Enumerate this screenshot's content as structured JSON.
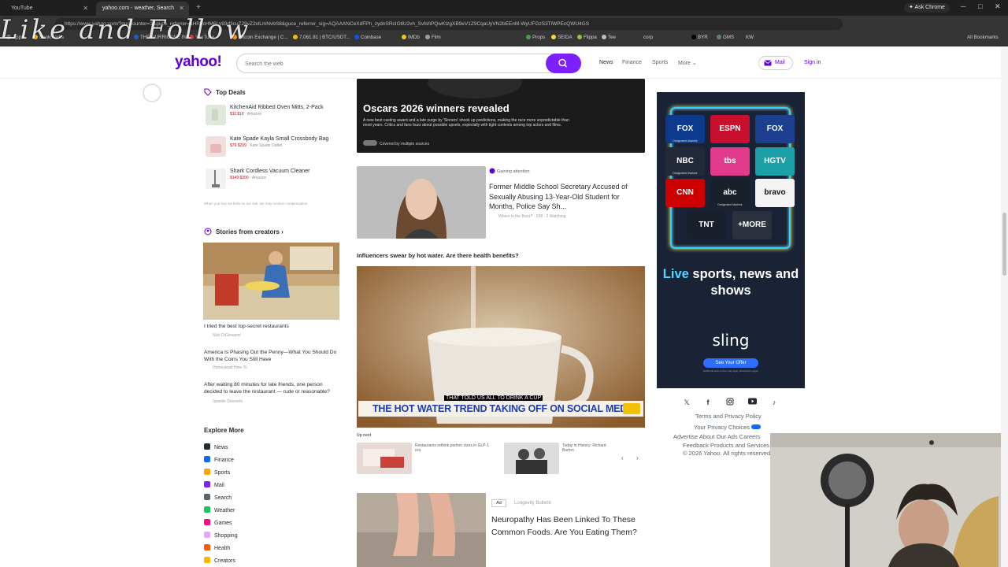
{
  "browser": {
    "tabs": [
      {
        "label": "YouTube"
      },
      {
        "label": "yahoo.com - weather, Search",
        "active": true
      }
    ],
    "ask_chrome": "Ask Chrome",
    "url": "https://www.yahoo.com/?guccounter=1&guce_referrer=aHR0cHM6Ly93d3cuZ29vZ2xlLmNvbS8&guce_referrer_sig=AQAAANCeXdFPh_zydnSRcIGtlU2vh_SvfshPQwKtzgXB9eV1Z9CqaUyVN2bEEnM-WyUFGzS3TlWPEcQWU4GS",
    "bookmarks": [
      "Apps",
      "Bookmarks",
      "THE HURRICANE INT...",
      "YouTube",
      "Bitcoin Exchange | C...",
      "7,061.81 | BTC/USDT...",
      "Coinbase",
      "IMDb",
      "Film",
      "Props",
      "SEIDA",
      "Flippa",
      "Tee",
      "corp",
      "BYR",
      "GMS",
      "KW",
      "All Bookmarks"
    ],
    "watermark": "Like and Follow"
  },
  "header": {
    "logo": "yahoo!",
    "search_placeholder": "Search the web",
    "nav": [
      "News",
      "Finance",
      "Sports",
      "More"
    ],
    "mail": "Mail",
    "signin": "Sign in"
  },
  "left": {
    "top_deals_title": "Top Deals",
    "deals": [
      {
        "name": "KitchenAid Ribbed Oven Mitts, 2-Pack",
        "price": "$11 $16",
        "store": "Amazon"
      },
      {
        "name": "Kate Spade Kayla Small Crossbody Bag",
        "price": "$79 $299",
        "store": "Kate Spade Outlet"
      },
      {
        "name": "Shark Cordless Vacuum Cleaner",
        "price": "$149 $300",
        "store": "Amazon"
      }
    ],
    "deals_note": "When you buy via links on our site, we may receive compensation.",
    "creators_title": "Stories from creators",
    "creator_story_1": "I tried the best top-secret restaurants",
    "creator_story_1_src": "Nick DiGiovanni",
    "creator_story_2": "America Is Phasing Out the Penny—What You Should Do With the Coins You Still Have",
    "creator_story_2_src": "Homestead How-To",
    "creator_story_3": "After waiting 80 minutes for late friends, one person decided to leave the restaurant — rude or reasonable?",
    "creator_story_3_src": "Sparkle Desserts",
    "explore_title": "Explore More",
    "explore": [
      {
        "label": "News",
        "color": "#232a31"
      },
      {
        "label": "Finance",
        "color": "#0f69ff"
      },
      {
        "label": "Sports",
        "color": "#ffa700"
      },
      {
        "label": "Mail",
        "color": "#7e1fff"
      },
      {
        "label": "Search",
        "color": "#5b636a"
      },
      {
        "label": "Weather",
        "color": "#1ac567"
      },
      {
        "label": "Games",
        "color": "#ff0b80"
      },
      {
        "label": "Shopping",
        "color": "#e0a8ff"
      },
      {
        "label": "Health",
        "color": "#ff5a00"
      },
      {
        "label": "Creators",
        "color": "#fdb700"
      }
    ]
  },
  "main": {
    "hero_title": "Oscars 2026 winners revealed",
    "hero_desc": "A new best casting award and a late surge by 'Sinners' shook up predictions, making the race more unpredictable than most years. Critics and fans buzz about possible upsets, especially with tight contests among top actors and films.",
    "hero_src": "Covered by multiple sources",
    "story_tag": "Gaining attention",
    "story_title": "Former Middle School Secretary Accused of Sexually Abusing 13-Year-Old Student for Months, Police Say Sh...",
    "story_meta": "Where is the Buzz? · 208 · 2 Watching",
    "video_heading": "Influencers swear by hot water. Are there health benefits?",
    "subtitle_small": "THAT TOLD US ALL TO DRINK A CUP",
    "subtitle_big": "THE HOT WATER TREND TAKING OFF ON SOCIAL MEDIA",
    "up_next": "Up next",
    "up_next_items": [
      {
        "caption": "Restaurants rethink portion sizes in GLP-1 era"
      },
      {
        "caption": "Today in History: Richard Burton"
      }
    ],
    "ad_badge": "Ad",
    "ad_sponsor": "Longevity Bulletin",
    "ad_title": "Neuropathy Has Been Linked To These Common Foods. Are You Eating Them?"
  },
  "right": {
    "networks": [
      {
        "label": "FOX",
        "sub": "Designated Markets",
        "color": "#0c3a8c"
      },
      {
        "label": "ESPN",
        "sub": "",
        "color": "#c8102e"
      },
      {
        "label": "FOX NEWS",
        "sub": "",
        "color": "#1d3f8f"
      },
      {
        "label": "NBC",
        "sub": "Designated Markets",
        "color": "#222a3a"
      },
      {
        "label": "tbs",
        "sub": "",
        "color": "#e23a8c"
      },
      {
        "label": "HGTV",
        "sub": "",
        "color": "#1ba0a8"
      },
      {
        "label": "CNN",
        "sub": "",
        "color": "#cc0000"
      },
      {
        "label": "abc",
        "sub": "Designated Markets",
        "color": "#1a1f2c"
      },
      {
        "label": "bravo",
        "sub": "",
        "color": "#f4f4f4"
      },
      {
        "label": "TNT",
        "sub": "",
        "color": "#1a1f2c"
      },
      {
        "label": "+MORE",
        "sub": "",
        "color": "#2c3140"
      }
    ],
    "tagline_live": "Live",
    "tagline_rest": " sports, news and shows",
    "brand": "sling",
    "cta": "See Your Offer",
    "fine": "Additional taxes & fees may apply. Restrictions apply.",
    "footer": {
      "terms": "Terms and Privacy Policy",
      "privacy": "Your Privacy Choices",
      "line3": "Advertise About Our Ads Careers",
      "line4": "Feedback Products and Services",
      "copyright": "© 2026 Yahoo. All rights reserved."
    }
  }
}
